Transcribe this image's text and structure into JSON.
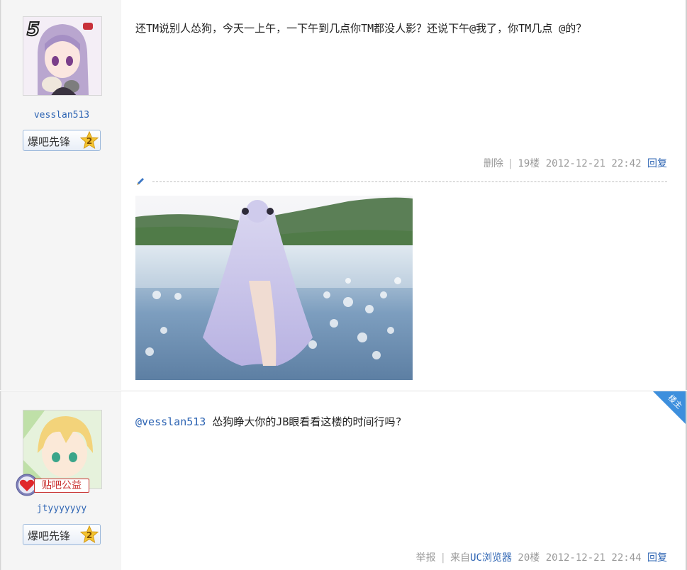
{
  "posts": [
    {
      "username": "vesslan513",
      "badge": {
        "label": "爆吧先锋",
        "level": "2"
      },
      "avatar_corner_number": "5",
      "content": "还TM说别人怂狗，今天一上午，一下午到几点你TM都没人影？还说下午@我了，你TM几点 @的？",
      "delete_label": "删除",
      "floor": "19楼",
      "timestamp": "2012-12-21 22:42",
      "reply_label": "回复"
    },
    {
      "username": "jtyyyyyyy",
      "badge": {
        "label": "爆吧先锋",
        "level": "2"
      },
      "charity_badge": "贴吧公益",
      "corner_tag": "楼主",
      "mention": "@vesslan513",
      "content": "怂狗睁大你的JB眼看看这楼的时间行吗?",
      "report_label": "举报",
      "source_prefix": "来自",
      "source_app": "UC浏览器",
      "floor": "20楼",
      "timestamp": "2012-12-21 22:44",
      "reply_label": "回复"
    }
  ],
  "colors": {
    "link": "#2d64b3",
    "sidebar": "#f5f5f5",
    "corner_tag": "#3d8fdd",
    "charity": "#c8302f"
  }
}
